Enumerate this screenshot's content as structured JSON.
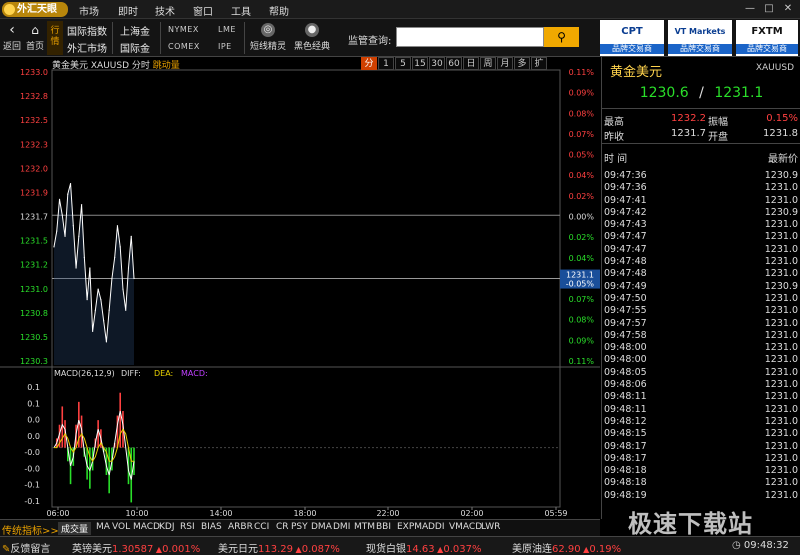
{
  "app": {
    "logo_text": "外汇天眼"
  },
  "menu": [
    "市场",
    "即时",
    "技术",
    "窗口",
    "工具",
    "帮助"
  ],
  "window_controls": [
    "—",
    "□",
    "✕"
  ],
  "toolbar": {
    "back_label": "返回",
    "home_label": "首页",
    "hangqing_label": "行情",
    "markets_left": [
      "国际指数",
      "外汇市场"
    ],
    "markets_mid": [
      "上海金",
      "国际金"
    ],
    "markets_right_top": [
      "NYMEX",
      "LME"
    ],
    "markets_right_bottom": [
      "COMEX",
      "IPE"
    ],
    "tool1_label": "短线精灵",
    "tool2_label": "黑色经典",
    "monitor_label": "监管查询:",
    "monitor_placeholder": "",
    "ads": [
      {
        "brand": "CPT",
        "sub": "品牌交易商"
      },
      {
        "brand": "VT Markets",
        "sub": "品牌交易商"
      },
      {
        "brand": "FXTM",
        "sub": "品牌交易商"
      }
    ]
  },
  "chart_header": {
    "name": "黄金美元",
    "code": "XAUUSD",
    "type_label": "分时",
    "mode_label": "跳动量",
    "periods": [
      "分",
      "1",
      "5",
      "15",
      "30",
      "60",
      "日",
      "周",
      "月",
      "多",
      "扩"
    ],
    "active_period": 0
  },
  "chart_data": [
    {
      "type": "line",
      "y_ticks": [
        "1233.0",
        "1232.8",
        "1232.5",
        "1232.3",
        "1232.0",
        "1231.9",
        "1231.7",
        "1231.5",
        "1231.2",
        "1231.0",
        "1230.8",
        "1230.5",
        "1230.3"
      ],
      "pct_ticks": [
        "0.11%",
        "0.09%",
        "0.08%",
        "0.07%",
        "0.05%",
        "0.04%",
        "0.02%",
        "0.00%",
        "0.02%",
        "0.04%",
        "0.05%",
        "0.07%",
        "0.08%",
        "0.09%",
        "0.11%"
      ],
      "ref_price": 1231.7,
      "current_price": "1231.1",
      "current_pct": "-0.05%",
      "x_ticks": [
        "06:00",
        "10:00",
        "14:00",
        "18:00",
        "22:00",
        "02:00",
        "05:59"
      ],
      "ylim": [
        1230.3,
        1233.0
      ],
      "series": [
        {
          "values": [
            1231.4,
            1231.55,
            1231.85,
            1231.7,
            1231.5,
            1231.9,
            1232.0,
            1231.6,
            1231.2,
            1231.5,
            1231.8,
            1231.3,
            1230.9,
            1231.2,
            1230.6,
            1230.8,
            1231.0,
            1230.9,
            1230.7,
            1230.5,
            1230.8,
            1231.1,
            1231.3,
            1231.6,
            1231.4,
            1231.0,
            1230.8,
            1231.2,
            1231.5,
            1231.1
          ]
        }
      ]
    },
    {
      "type": "bar",
      "title": "MACD(26,12,9)",
      "labels": [
        "DIFF:",
        "DEA:",
        "MACD:"
      ],
      "y_ticks": [
        "0.1",
        "0.1",
        "0.0",
        "0.0",
        "-0.0",
        "-0.0",
        "-0.1",
        "-0.1"
      ],
      "ylim": [
        -0.13,
        0.15
      ],
      "macd": [
        0.0,
        0.02,
        0.05,
        0.09,
        0.06,
        -0.03,
        -0.08,
        -0.04,
        0.05,
        0.1,
        0.07,
        -0.02,
        -0.07,
        -0.09,
        -0.05,
        0.02,
        0.06,
        0.04,
        -0.01,
        -0.06,
        -0.1,
        -0.05,
        0.01,
        0.07,
        0.12,
        0.08,
        0.0,
        -0.08,
        -0.12,
        -0.06
      ],
      "diff": [
        0.0,
        0.01,
        0.03,
        0.05,
        0.04,
        0.0,
        -0.04,
        -0.02,
        0.03,
        0.06,
        0.04,
        -0.01,
        -0.04,
        -0.05,
        -0.03,
        0.01,
        0.04,
        0.02,
        -0.01,
        -0.04,
        -0.06,
        -0.03,
        0.01,
        0.05,
        0.08,
        0.05,
        0.0,
        -0.05,
        -0.07,
        -0.03
      ],
      "dea": [
        0.0,
        0.0,
        0.01,
        0.02,
        0.03,
        0.02,
        0.0,
        -0.01,
        0.0,
        0.02,
        0.03,
        0.02,
        0.0,
        -0.02,
        -0.03,
        -0.02,
        0.0,
        0.01,
        0.0,
        -0.01,
        -0.03,
        -0.03,
        -0.02,
        0.0,
        0.03,
        0.04,
        0.03,
        0.0,
        -0.03,
        -0.03
      ]
    }
  ],
  "quote": {
    "name": "黄金美元",
    "code": "XAUUSD",
    "bid": "1230.6",
    "sep": "/",
    "ask": "1231.1",
    "high_label": "最高",
    "high": "1232.2",
    "amp_label": "振幅",
    "amp": "0.15%",
    "prev_label": "昨收",
    "prev": "1231.7",
    "open_label": "开盘",
    "open": "1231.8",
    "time_header": "时 间",
    "price_header": "最新价",
    "ticks": [
      [
        "09:47:36",
        "1230.9"
      ],
      [
        "09:47:36",
        "1231.0"
      ],
      [
        "09:47:41",
        "1231.0"
      ],
      [
        "09:47:42",
        "1230.9"
      ],
      [
        "09:47:43",
        "1231.0"
      ],
      [
        "09:47:47",
        "1231.0"
      ],
      [
        "09:47:47",
        "1231.0"
      ],
      [
        "09:47:48",
        "1231.0"
      ],
      [
        "09:47:48",
        "1231.0"
      ],
      [
        "09:47:49",
        "1230.9"
      ],
      [
        "09:47:50",
        "1231.0"
      ],
      [
        "09:47:55",
        "1231.0"
      ],
      [
        "09:47:57",
        "1231.0"
      ],
      [
        "09:47:58",
        "1231.0"
      ],
      [
        "09:48:00",
        "1231.0"
      ],
      [
        "09:48:00",
        "1231.0"
      ],
      [
        "09:48:05",
        "1231.0"
      ],
      [
        "09:48:06",
        "1231.0"
      ],
      [
        "09:48:11",
        "1231.0"
      ],
      [
        "09:48:11",
        "1231.0"
      ],
      [
        "09:48:12",
        "1231.0"
      ],
      [
        "09:48:15",
        "1231.0"
      ],
      [
        "09:48:17",
        "1231.0"
      ],
      [
        "09:48:17",
        "1231.0"
      ],
      [
        "09:48:18",
        "1231.0"
      ],
      [
        "09:48:18",
        "1231.0"
      ],
      [
        "09:48:19",
        "1231.0"
      ]
    ]
  },
  "indicators": {
    "label": "传统指标>>",
    "items": [
      "成交量",
      "MA",
      "VOL",
      "MACD",
      "KDJ",
      "RSI",
      "BIAS",
      "ARBR",
      "CCI",
      "CR",
      "PSY",
      "DMA",
      "DMI",
      "MTM",
      "BBI",
      "EXPMA",
      "DDI",
      "VMACD",
      "LWR"
    ]
  },
  "statusbar": {
    "feedback": "反馈留言",
    "quotes": [
      {
        "name": "英镑美元",
        "price": "1.30587",
        "pct": "0.001%"
      },
      {
        "name": "美元日元",
        "price": "113.29",
        "pct": "0.087%"
      },
      {
        "name": "现货白银",
        "price": "14.63",
        "pct": "0.037%"
      },
      {
        "name": "美原油连",
        "price": "62.90",
        "pct": "0.19%"
      }
    ],
    "clock": "09:48:32"
  },
  "watermark": "极速下载站",
  "colors": {
    "up": "#ff4040",
    "down": "#2adf2a",
    "accent": "#e8a000",
    "line": "#ffffff",
    "ref": "#888888"
  }
}
